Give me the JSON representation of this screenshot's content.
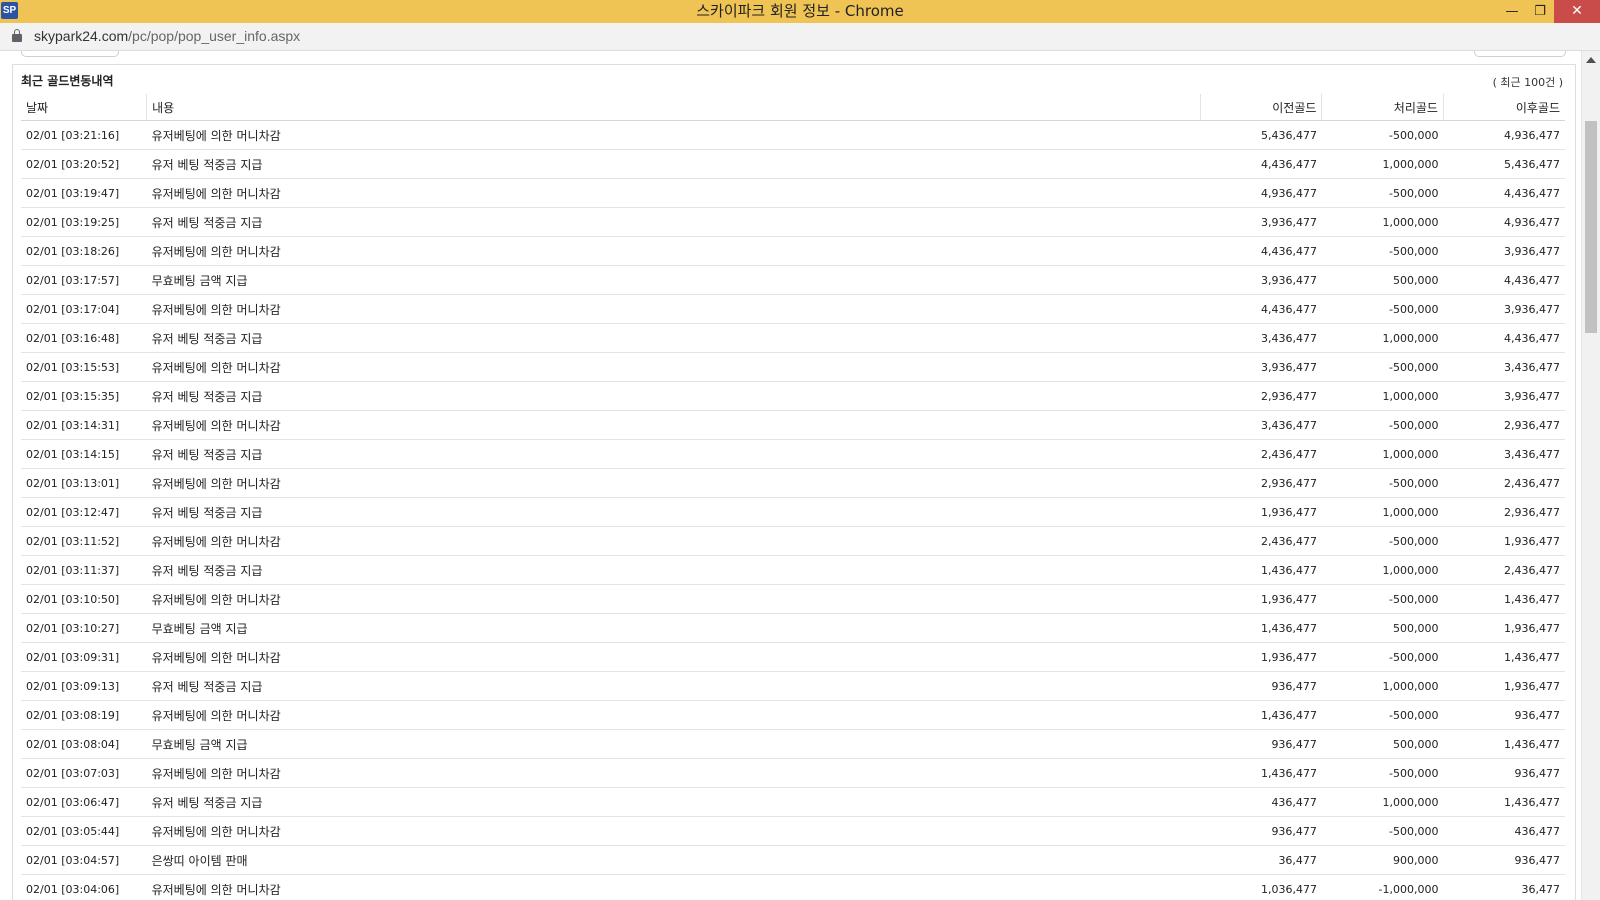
{
  "window": {
    "logo": "SP",
    "title": "스카이파크 회원 정보 - Chrome",
    "minimize_icon": "minimize-icon",
    "maximize_icon": "restore-icon",
    "close_icon": "close-icon"
  },
  "address": {
    "domain": "skypark24.com",
    "path": "/pc/pop/pop_user_info.aspx"
  },
  "section": {
    "title": "최근 골드변동내역",
    "count_note": "( 최근 100건 )"
  },
  "table": {
    "headers": [
      "날짜",
      "내용",
      "이전골드",
      "처리골드",
      "이후골드"
    ],
    "rows": [
      [
        "02/01 [03:21:16]",
        "유저베팅에 의한 머니차감",
        "5,436,477",
        "-500,000",
        "4,936,477"
      ],
      [
        "02/01 [03:20:52]",
        "유저 베팅 적중금 지급",
        "4,436,477",
        "1,000,000",
        "5,436,477"
      ],
      [
        "02/01 [03:19:47]",
        "유저베팅에 의한 머니차감",
        "4,936,477",
        "-500,000",
        "4,436,477"
      ],
      [
        "02/01 [03:19:25]",
        "유저 베팅 적중금 지급",
        "3,936,477",
        "1,000,000",
        "4,936,477"
      ],
      [
        "02/01 [03:18:26]",
        "유저베팅에 의한 머니차감",
        "4,436,477",
        "-500,000",
        "3,936,477"
      ],
      [
        "02/01 [03:17:57]",
        "무효베팅 금액 지급",
        "3,936,477",
        "500,000",
        "4,436,477"
      ],
      [
        "02/01 [03:17:04]",
        "유저베팅에 의한 머니차감",
        "4,436,477",
        "-500,000",
        "3,936,477"
      ],
      [
        "02/01 [03:16:48]",
        "유저 베팅 적중금 지급",
        "3,436,477",
        "1,000,000",
        "4,436,477"
      ],
      [
        "02/01 [03:15:53]",
        "유저베팅에 의한 머니차감",
        "3,936,477",
        "-500,000",
        "3,436,477"
      ],
      [
        "02/01 [03:15:35]",
        "유저 베팅 적중금 지급",
        "2,936,477",
        "1,000,000",
        "3,936,477"
      ],
      [
        "02/01 [03:14:31]",
        "유저베팅에 의한 머니차감",
        "3,436,477",
        "-500,000",
        "2,936,477"
      ],
      [
        "02/01 [03:14:15]",
        "유저 베팅 적중금 지급",
        "2,436,477",
        "1,000,000",
        "3,436,477"
      ],
      [
        "02/01 [03:13:01]",
        "유저베팅에 의한 머니차감",
        "2,936,477",
        "-500,000",
        "2,436,477"
      ],
      [
        "02/01 [03:12:47]",
        "유저 베팅 적중금 지급",
        "1,936,477",
        "1,000,000",
        "2,936,477"
      ],
      [
        "02/01 [03:11:52]",
        "유저베팅에 의한 머니차감",
        "2,436,477",
        "-500,000",
        "1,936,477"
      ],
      [
        "02/01 [03:11:37]",
        "유저 베팅 적중금 지급",
        "1,436,477",
        "1,000,000",
        "2,436,477"
      ],
      [
        "02/01 [03:10:50]",
        "유저베팅에 의한 머니차감",
        "1,936,477",
        "-500,000",
        "1,436,477"
      ],
      [
        "02/01 [03:10:27]",
        "무효베팅 금액 지급",
        "1,436,477",
        "500,000",
        "1,936,477"
      ],
      [
        "02/01 [03:09:31]",
        "유저베팅에 의한 머니차감",
        "1,936,477",
        "-500,000",
        "1,436,477"
      ],
      [
        "02/01 [03:09:13]",
        "유저 베팅 적중금 지급",
        "936,477",
        "1,000,000",
        "1,936,477"
      ],
      [
        "02/01 [03:08:19]",
        "유저베팅에 의한 머니차감",
        "1,436,477",
        "-500,000",
        "936,477"
      ],
      [
        "02/01 [03:08:04]",
        "무효베팅 금액 지급",
        "936,477",
        "500,000",
        "1,436,477"
      ],
      [
        "02/01 [03:07:03]",
        "유저베팅에 의한 머니차감",
        "1,436,477",
        "-500,000",
        "936,477"
      ],
      [
        "02/01 [03:06:47]",
        "유저 베팅 적중금 지급",
        "436,477",
        "1,000,000",
        "1,436,477"
      ],
      [
        "02/01 [03:05:44]",
        "유저베팅에 의한 머니차감",
        "936,477",
        "-500,000",
        "436,477"
      ],
      [
        "02/01 [03:04:57]",
        "은쌍띠 아이템 판매",
        "36,477",
        "900,000",
        "936,477"
      ],
      [
        "02/01 [03:04:06]",
        "유저베팅에 의한 머니차감",
        "1,036,477",
        "-1,000,000",
        "36,477"
      ]
    ]
  },
  "colors": {
    "titlebar": "#f0c454",
    "close_button": "#c94c4b",
    "address_bar": "#f2f2f2"
  }
}
